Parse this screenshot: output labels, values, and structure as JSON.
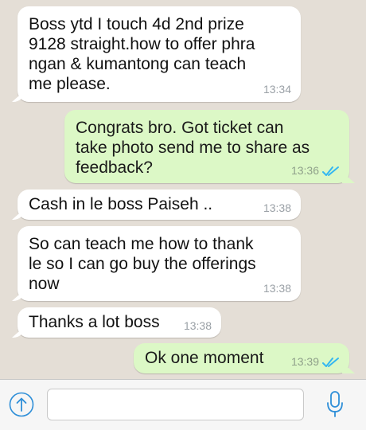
{
  "messages": [
    {
      "direction": "incoming",
      "text": "Boss ytd I touch 4d 2nd prize\n9128 straight.how to offer phra\nngan & kumantong can teach\nme please.",
      "time": "13:34"
    },
    {
      "direction": "outgoing",
      "text": "Congrats bro. Got ticket can\ntake photo send me to share as\nfeedback?",
      "time": "13:36",
      "status": "read"
    },
    {
      "direction": "incoming",
      "text": "Cash in le boss Paiseh ..",
      "time": "13:38"
    },
    {
      "direction": "incoming",
      "text": "So can teach me how to thank\nle so I can go buy the offerings\nnow",
      "time": "13:38"
    },
    {
      "direction": "incoming",
      "text": "Thanks a lot boss",
      "time": "13:38"
    },
    {
      "direction": "outgoing",
      "text": "Ok one moment",
      "time": "13:39",
      "status": "read"
    }
  ],
  "input_bar": {
    "message_value": "",
    "attach_icon": "attach-arrow-up-icon",
    "mic_icon": "microphone-icon"
  },
  "colors": {
    "chat_background": "#e4ded6",
    "incoming_bubble": "#ffffff",
    "outgoing_bubble": "#dcf8c6",
    "read_ticks": "#34b7f1",
    "accent_blue": "#2f8fd8"
  }
}
